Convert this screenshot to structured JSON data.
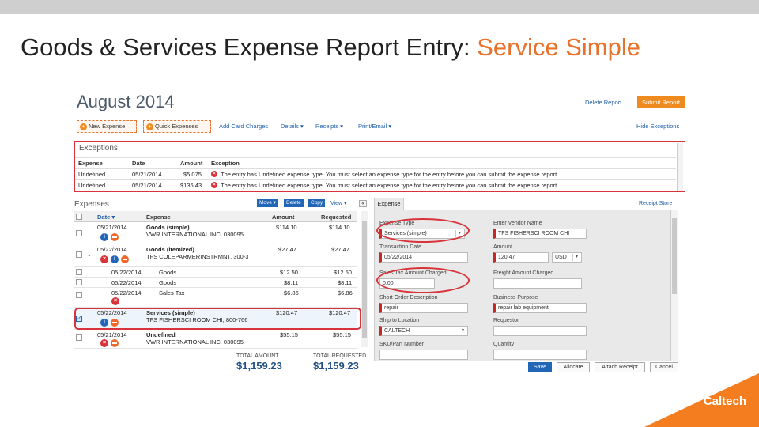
{
  "slide": {
    "title_prefix": "Goods & Services Expense Report Entry: ",
    "title_accent": "Service Simple",
    "logo": "Caltech"
  },
  "report": {
    "month": "August 2014",
    "delete_label": "Delete Report",
    "submit_label": "Submit Report"
  },
  "toolbar": {
    "new_expense": "New Expense",
    "quick_expenses": "Quick Expenses",
    "add_card_charges": "Add Card Charges",
    "details": "Details ▾",
    "receipts": "Receipts ▾",
    "print_email": "Print/Email ▾",
    "hide_exceptions": "Hide Exceptions"
  },
  "exceptions": {
    "title": "Exceptions",
    "headers": [
      "Expense",
      "Date",
      "Amount",
      "Exception"
    ],
    "rows": [
      {
        "expense": "Undefined",
        "date": "05/21/2014",
        "amount": "$5,075",
        "message": "The entry has Undefined expense type. You must select an expense type for the entry before you can submit the expense report."
      },
      {
        "expense": "Undefined",
        "date": "05/21/2014",
        "amount": "$136.43",
        "message": "The entry has Undefined expense type. You must select an expense type for the entry before you can submit the expense report."
      }
    ]
  },
  "expenses": {
    "title": "Expenses",
    "move_label": "Move ▾",
    "delete_label": "Delete",
    "copy_label": "Copy",
    "view_label": "View ▾",
    "collapse_label": "«",
    "headers": {
      "date": "Date ▾",
      "expense": "Expense",
      "amount": "Amount",
      "requested": "Requested"
    },
    "rows": [
      {
        "date": "05/21/2014",
        "title": "Goods (simple)",
        "vendor": "VWR INTERNATIONAL INC. 030095",
        "amount": "$114.10",
        "requested": "$114.10",
        "checked": false,
        "icons": "im"
      },
      {
        "date": "05/22/2014",
        "title": "Goods (itemized)",
        "vendor": "TFS COLEPARMERINSTRMNT, 300-3",
        "amount": "$27.47",
        "requested": "$27.47",
        "checked": false,
        "icons": "xim"
      },
      {
        "date": "05/22/2014",
        "title": "Goods",
        "vendor": "",
        "amount": "$12.50",
        "requested": "$12.50",
        "checked": false,
        "icons": ""
      },
      {
        "date": "05/22/2014",
        "title": "Goods",
        "vendor": "",
        "amount": "$8.11",
        "requested": "$8.11",
        "checked": false,
        "icons": ""
      },
      {
        "date": "05/22/2014",
        "title": "Sales Tax",
        "vendor": "",
        "amount": "$6.86",
        "requested": "$6.86",
        "checked": false,
        "icons": "x"
      },
      {
        "date": "05/22/2014",
        "title": "Services (simple)",
        "vendor": "TFS FISHERSCI ROOM CHI, 800-766",
        "amount": "$120.47",
        "requested": "$120.47",
        "checked": true,
        "icons": "im"
      },
      {
        "date": "05/21/2014",
        "title": "Undefined",
        "vendor": "VWR INTERNATIONAL INC. 030095",
        "amount": "$55.15",
        "requested": "$55.15",
        "checked": false,
        "icons": "xm"
      }
    ],
    "total_amount_label": "TOTAL AMOUNT",
    "total_amount": "$1,159.23",
    "total_requested_label": "TOTAL REQUESTED",
    "total_requested": "$1,159.23"
  },
  "form": {
    "tab_label": "Expense",
    "receipt_link": "Receipt Store",
    "expense_type_label": "Expense Type",
    "expense_type_value": "Services (simple)",
    "vendor_label": "Enter Vendor Name",
    "vendor_value": "TFS FISHERSCI ROOM CHI",
    "txn_date_label": "Transaction Date",
    "txn_date_value": "05/22/2014",
    "amount_label": "Amount",
    "amount_value": "120.47",
    "currency_value": "USD",
    "sales_tax_label": "Sales Tax Amount Charged",
    "sales_tax_value": "0.00",
    "freight_label": "Freight Amount Charged",
    "freight_value": "",
    "short_desc_label": "Short Order Description",
    "short_desc_value": "repair",
    "business_purpose_label": "Business Purpose",
    "business_purpose_value": "repair lab equipment",
    "ship_to_label": "Ship to Location",
    "ship_to_value": "CALTECH",
    "requestor_label": "Requestor",
    "requestor_value": "",
    "sku_label": "SKU/Part Number",
    "sku_value": "",
    "quantity_label": "Quantity",
    "quantity_value": ""
  },
  "footer": {
    "save": "Save",
    "allocate": "Allocate",
    "attach_receipt": "Attach Receipt",
    "cancel": "Cancel"
  },
  "colors": {
    "accent": "#e8722c",
    "primary": "#2266b8",
    "error": "#d8333a"
  }
}
